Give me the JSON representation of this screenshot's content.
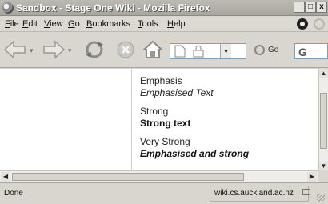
{
  "window": {
    "title": "Sandbox - Stage One Wiki - Mozilla Firefox",
    "controls": {
      "minimize": "_",
      "maximize": "□",
      "close": "x"
    }
  },
  "menu": {
    "items": [
      {
        "label": "File"
      },
      {
        "label": "Edit"
      },
      {
        "label": "View"
      },
      {
        "label": "Go"
      },
      {
        "label": "Bookmarks"
      },
      {
        "label": "Tools"
      },
      {
        "label": "Help"
      }
    ]
  },
  "toolbar": {
    "go_label": "Go",
    "icons": [
      "back-icon",
      "forward-icon",
      "reload-icon",
      "stop-icon",
      "home-icon",
      "page-icon",
      "lock-dropdown-icon",
      "go-icon",
      "search-icon"
    ],
    "url_value": "G"
  },
  "content": {
    "examples": [
      {
        "label": "Emphasis",
        "example": "Emphasised Text"
      },
      {
        "label": "Strong",
        "example": "Strong text"
      },
      {
        "label": "Very Strong",
        "example": "Emphasised and strong"
      }
    ]
  },
  "status": {
    "text": "Done",
    "domain": "wiki.cs.auckland.ac.nz"
  },
  "colors": {
    "chrome": "#d9d6cf",
    "titlebar": "#a9a69f",
    "content_bg": "#ffffff"
  }
}
